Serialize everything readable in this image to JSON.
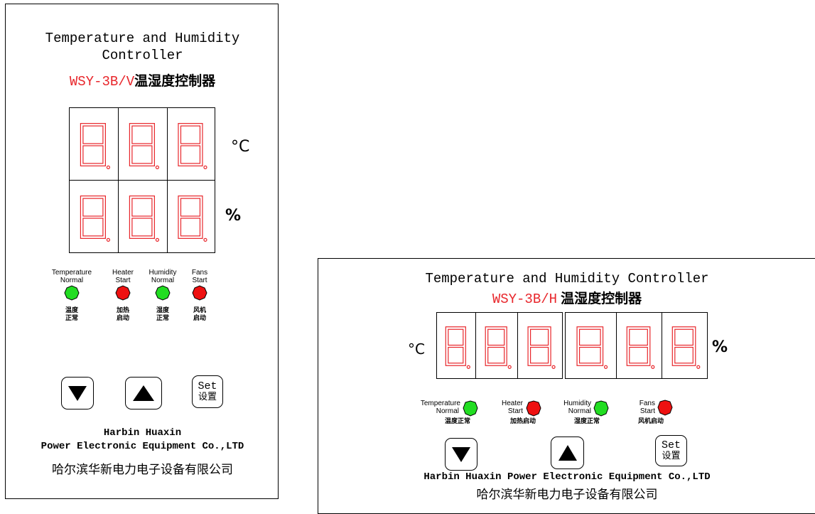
{
  "vertical": {
    "title_line1": "Temperature and Humidity",
    "title_line2": "Controller",
    "model": "WSY-3B/V",
    "model_cn": "温湿度控制器",
    "temp_unit": "°C",
    "hum_unit": "%",
    "indicators": [
      {
        "en1": "Temperature",
        "en2": "Normal",
        "cn1": "温度",
        "cn2": "正常",
        "color": "#22dd22"
      },
      {
        "en1": "Heater",
        "en2": "Start",
        "cn1": "加热",
        "cn2": "启动",
        "color": "#ee1111"
      },
      {
        "en1": "Humidity",
        "en2": "Normal",
        "cn1": "湿度",
        "cn2": "正常",
        "color": "#22dd22"
      },
      {
        "en1": "Fans",
        "en2": "Start",
        "cn1": "风机",
        "cn2": "启动",
        "color": "#ee1111"
      }
    ],
    "set_en": "Set",
    "set_cn": "设置",
    "company_line1": "Harbin Huaxin",
    "company_line2": "Power Electronic Equipment Co.,LTD",
    "company_cn": "哈尔滨华新电力电子设备有限公司"
  },
  "horizontal": {
    "title": "Temperature and Humidity Controller",
    "model": "WSY-3B/H",
    "model_cn": "温湿度控制器",
    "temp_unit": "°C",
    "hum_unit": "%",
    "indicators": [
      {
        "en1": "Temperature",
        "en2": "Normal",
        "cn": "温度正常",
        "color": "#22dd22"
      },
      {
        "en1": "Heater",
        "en2": "Start",
        "cn": "加热启动",
        "color": "#ee1111"
      },
      {
        "en1": "Humidity",
        "en2": "Normal",
        "cn": "湿度正常",
        "color": "#22dd22"
      },
      {
        "en1": "Fans",
        "en2": "Start",
        "cn": "风机启动",
        "color": "#ee1111"
      }
    ],
    "set_en": "Set",
    "set_cn": "设置",
    "company_line1": "Harbin Huaxin Power Electronic Equipment Co.,LTD",
    "company_cn": "哈尔滨华新电力电子设备有限公司"
  },
  "colors": {
    "segment": "#e8262b",
    "green_led": "#22dd22",
    "red_led": "#ee1111"
  }
}
